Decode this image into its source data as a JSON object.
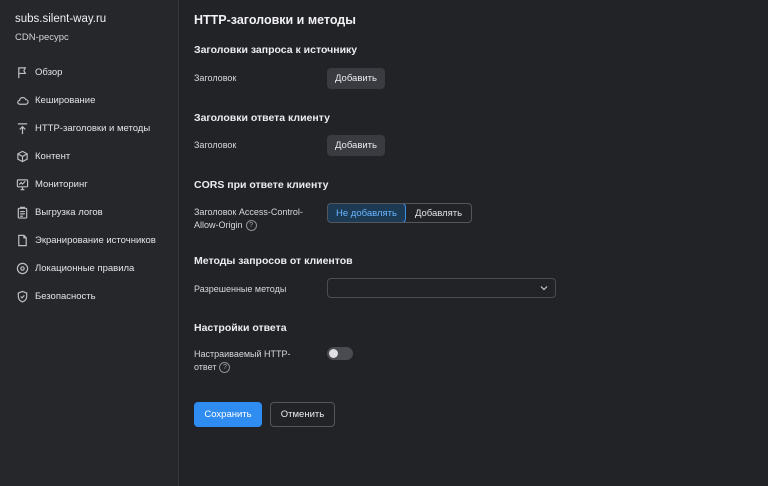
{
  "resource": {
    "name": "subs.silent-way.ru",
    "type": "CDN-ресурс"
  },
  "sidebar": {
    "items": [
      {
        "label": "Обзор",
        "icon": "flag-icon"
      },
      {
        "label": "Кеширование",
        "icon": "cloud-icon"
      },
      {
        "label": "HTTP-заголовки и методы",
        "icon": "upload-icon"
      },
      {
        "label": "Контент",
        "icon": "cube-icon"
      },
      {
        "label": "Мониторинг",
        "icon": "monitor-icon"
      },
      {
        "label": "Выгрузка логов",
        "icon": "clipboard-icon"
      },
      {
        "label": "Экранирование источников",
        "icon": "document-icon"
      },
      {
        "label": "Локационные правила",
        "icon": "location-icon"
      },
      {
        "label": "Безопасность",
        "icon": "shield-icon"
      }
    ]
  },
  "main": {
    "title": "HTTP-заголовки и методы",
    "request_headers": {
      "title": "Заголовки запроса к источнику",
      "label": "Заголовок",
      "button": "Добавить"
    },
    "response_headers": {
      "title": "Заголовки ответа клиенту",
      "label": "Заголовок",
      "button": "Добавить"
    },
    "cors": {
      "title": "CORS при ответе клиенту",
      "label_line1": "Заголовок Access-Control-",
      "label_line2": "Allow-Origin",
      "help": "?",
      "options": [
        "Не добавлять",
        "Добавлять"
      ],
      "selected": "Не добавлять"
    },
    "methods": {
      "title": "Методы запросов от клиентов",
      "label": "Разрешенные методы",
      "value": ""
    },
    "response_settings": {
      "title": "Настройки ответа",
      "label_line1": "Настраиваемый HTTP-",
      "label_line2": "ответ",
      "help": "?",
      "toggle_on": false
    },
    "actions": {
      "save": "Сохранить",
      "cancel": "Отменить"
    }
  },
  "colors": {
    "accent": "#2f8cf0",
    "background": "#222327",
    "sidebar": "#26272b"
  }
}
